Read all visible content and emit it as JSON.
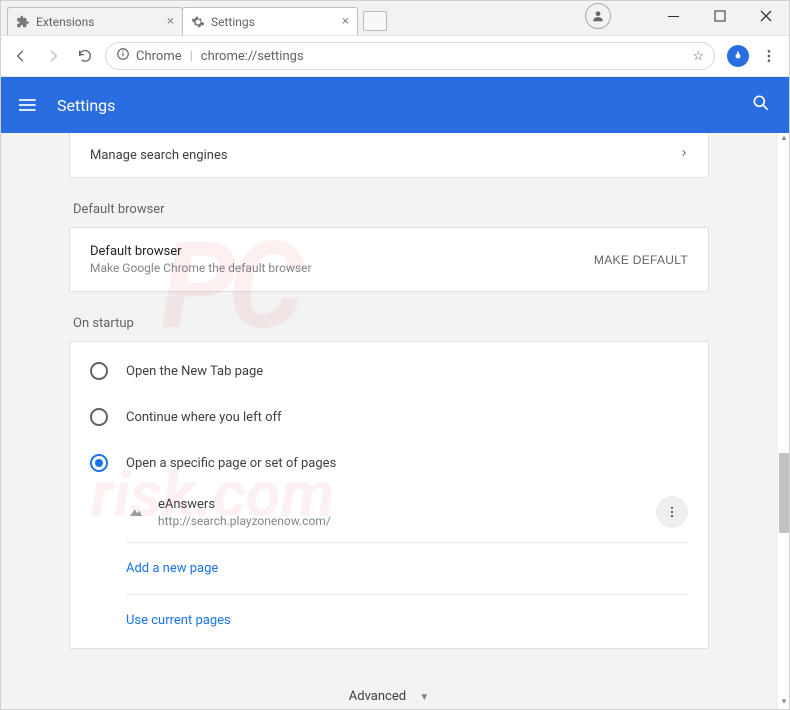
{
  "window": {
    "tabs": [
      {
        "label": "Extensions",
        "active": false
      },
      {
        "label": "Settings",
        "active": true
      }
    ]
  },
  "omnibox": {
    "security_label": "Chrome",
    "url": "chrome://settings"
  },
  "appbar": {
    "title": "Settings"
  },
  "search_engine_row": {
    "label": "Manage search engines"
  },
  "default_browser_section": {
    "header": "Default browser",
    "title": "Default browser",
    "subtitle": "Make Google Chrome the default browser",
    "button": "MAKE DEFAULT"
  },
  "startup_section": {
    "header": "On startup",
    "options": [
      "Open the New Tab page",
      "Continue where you left off",
      "Open a specific page or set of pages"
    ],
    "pages": [
      {
        "title": "eAnswers",
        "url": "http://search.playzonenow.com/"
      }
    ],
    "add_page": "Add a new page",
    "use_current": "Use current pages"
  },
  "advanced_label": "Advanced"
}
